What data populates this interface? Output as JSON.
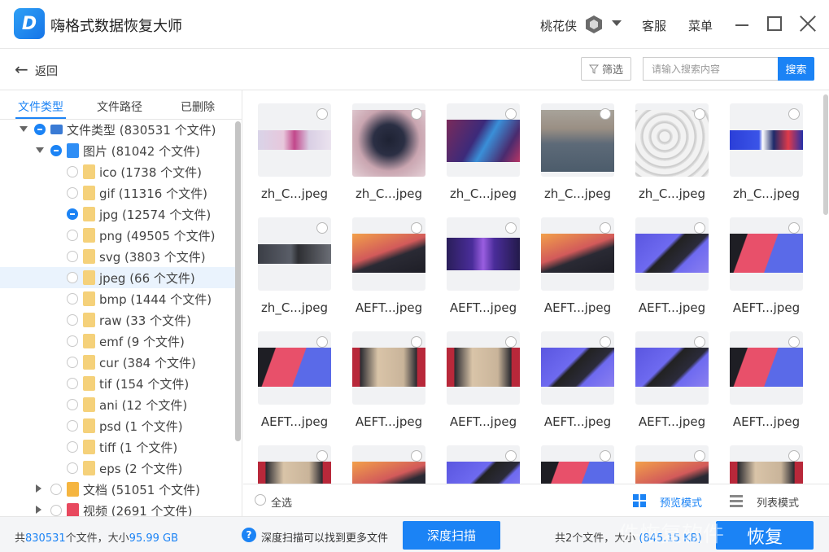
{
  "app": {
    "title": "嗨格式数据恢复大师",
    "logo_letter": "D",
    "user_name": "桃花侠",
    "service_label": "客服",
    "menu_label": "菜单"
  },
  "toolbar": {
    "back_label": "返回",
    "filter_label": "筛选",
    "search_placeholder": "请输入搜索内容",
    "search_button": "搜索"
  },
  "sidebar": {
    "tabs": [
      "文件类型",
      "文件路径",
      "已删除"
    ],
    "active_tab": 0,
    "tree": [
      {
        "label": "文件类型 (830531 个文件)",
        "icon": "computer-icon",
        "level": 0,
        "expanded": true,
        "state": "partial"
      },
      {
        "label": "图片 (81042 个文件)",
        "icon": "image-folder-icon",
        "level": 1,
        "expanded": true,
        "state": "partial"
      },
      {
        "label": "ico (1738 个文件)",
        "icon": "folder-icon",
        "level": 2,
        "state": "none"
      },
      {
        "label": "gif (11316 个文件)",
        "icon": "folder-icon",
        "level": 2,
        "state": "none"
      },
      {
        "label": "jpg (12574 个文件)",
        "icon": "folder-icon",
        "level": 2,
        "state": "partial"
      },
      {
        "label": "png (49505 个文件)",
        "icon": "folder-icon",
        "level": 2,
        "state": "none"
      },
      {
        "label": "svg (3803 个文件)",
        "icon": "folder-icon",
        "level": 2,
        "state": "none"
      },
      {
        "label": "jpeg (66 个文件)",
        "icon": "folder-icon",
        "level": 2,
        "state": "none",
        "selected": true
      },
      {
        "label": "bmp (1444 个文件)",
        "icon": "folder-icon",
        "level": 2,
        "state": "none"
      },
      {
        "label": "raw (33 个文件)",
        "icon": "folder-icon",
        "level": 2,
        "state": "none"
      },
      {
        "label": "emf (9 个文件)",
        "icon": "folder-icon",
        "level": 2,
        "state": "none"
      },
      {
        "label": "cur (384 个文件)",
        "icon": "folder-icon",
        "level": 2,
        "state": "none"
      },
      {
        "label": "tif (154 个文件)",
        "icon": "folder-icon",
        "level": 2,
        "state": "none"
      },
      {
        "label": "ani (12 个文件)",
        "icon": "folder-icon",
        "level": 2,
        "state": "none"
      },
      {
        "label": "psd (1 个文件)",
        "icon": "folder-icon",
        "level": 2,
        "state": "none"
      },
      {
        "label": "tiff (1 个文件)",
        "icon": "folder-icon",
        "level": 2,
        "state": "none"
      },
      {
        "label": "eps (2 个文件)",
        "icon": "folder-icon",
        "level": 2,
        "state": "none"
      },
      {
        "label": "文档 (51051 个文件)",
        "icon": "document-folder-icon",
        "level": 1,
        "expanded": false,
        "state": "none"
      },
      {
        "label": "视频 (2691 个文件)",
        "icon": "video-folder-icon",
        "level": 1,
        "expanded": false,
        "state": "none"
      }
    ]
  },
  "grid": {
    "files": [
      {
        "name": "zh_C...jpeg",
        "thumb": "banner-magenta-dancer"
      },
      {
        "name": "zh_C...jpeg",
        "thumb": "dark-face-particles"
      },
      {
        "name": "zh_C...jpeg",
        "thumb": "purple-blue-warrior"
      },
      {
        "name": "zh_C...jpeg",
        "thumb": "ocean-dragon"
      },
      {
        "name": "zh_C...jpeg",
        "thumb": "grey-machinery"
      },
      {
        "name": "zh_C...jpeg",
        "thumb": "blue-web-banner"
      },
      {
        "name": "zh_C...jpeg",
        "thumb": "grey-photographer-banner"
      },
      {
        "name": "AEFT...jpeg",
        "thumb": "sunset-wing-app"
      },
      {
        "name": "AEFT...jpeg",
        "thumb": "purple-banner-app"
      },
      {
        "name": "AEFT...jpeg",
        "thumb": "sunset-wing-app"
      },
      {
        "name": "AEFT...jpeg",
        "thumb": "purple-laptop-app"
      },
      {
        "name": "AEFT...jpeg",
        "thumb": "pink-blue-split-app"
      },
      {
        "name": "AEFT...jpeg",
        "thumb": "pink-blue-split-app"
      },
      {
        "name": "AEFT...jpeg",
        "thumb": "red-desert-app"
      },
      {
        "name": "AEFT...jpeg",
        "thumb": "red-desert-app"
      },
      {
        "name": "AEFT...jpeg",
        "thumb": "purple-laptop-app"
      },
      {
        "name": "AEFT...jpeg",
        "thumb": "purple-laptop-app"
      },
      {
        "name": "AEFT...jpeg",
        "thumb": "pink-blue-split-app"
      },
      {
        "name": "",
        "thumb": "red-desert-app"
      },
      {
        "name": "",
        "thumb": "sunset-wing-app"
      },
      {
        "name": "",
        "thumb": "purple-laptop-app"
      },
      {
        "name": "",
        "thumb": "pink-blue-split-app"
      },
      {
        "name": "",
        "thumb": "sunset-wing-app"
      },
      {
        "name": "",
        "thumb": "red-desert-app"
      }
    ],
    "select_all_label": "全选",
    "preview_mode_label": "预览模式",
    "list_mode_label": "列表模式"
  },
  "status": {
    "total_prefix": "共",
    "total_count": "830531",
    "total_mid": "个文件，大小",
    "total_size": "95.99 GB",
    "help_text": "深度扫描可以找到更多文件",
    "deep_scan_button": "深度扫描",
    "selected_text": "共2个文件，大小",
    "selected_size": "(845.15 KB)",
    "recover_button": "恢复",
    "watermark": "件恢复软件"
  },
  "colors": {
    "accent": "#1b83f5"
  }
}
